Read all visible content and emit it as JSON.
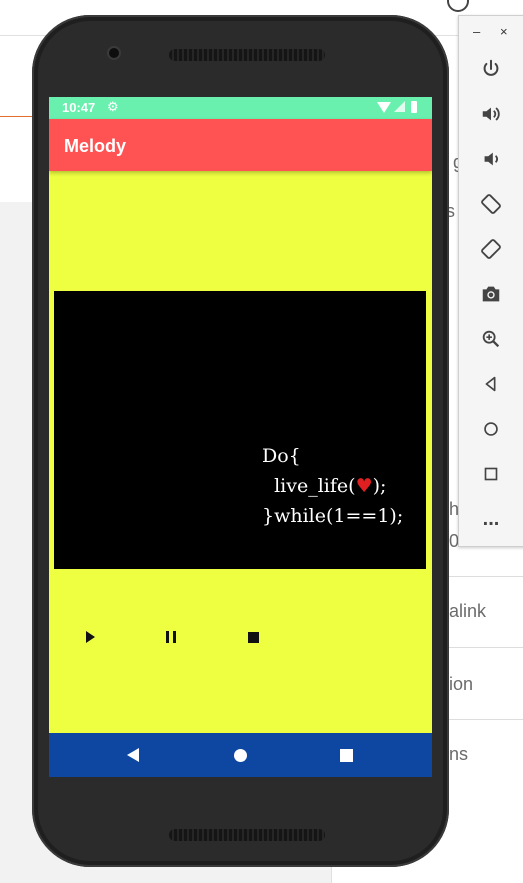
{
  "background": {
    "right_texts": [
      "g",
      "s",
      "h",
      "0",
      "alink",
      "ion",
      "ns"
    ]
  },
  "statusbar": {
    "time": "10:47",
    "settings_icon": "gear-icon",
    "wifi_icon": "wifi-icon",
    "signal_icon": "signal-icon",
    "battery_icon": "battery-icon",
    "color": "#69f0ae"
  },
  "appbar": {
    "title": "Melody",
    "color": "#ff5252"
  },
  "screen": {
    "background": "#eeff41"
  },
  "video": {
    "line1": "Do{",
    "line2_prefix": "  live_life(",
    "heart": "♥",
    "line2_suffix": ");",
    "line3": "}while(1==1);"
  },
  "controls": {
    "play_icon": "play-icon",
    "pause_icon": "pause-icon",
    "stop_icon": "stop-icon"
  },
  "navbar": {
    "color": "#0d47a1",
    "back_icon": "back-icon",
    "home_icon": "home-icon",
    "recent_icon": "recent-apps-icon"
  },
  "emulator": {
    "minimize": "–",
    "close": "×",
    "buttons": [
      "power-icon",
      "volume-up-icon",
      "volume-down-icon",
      "rotate-left-icon",
      "rotate-right-icon",
      "camera-icon",
      "zoom-icon",
      "back-icon",
      "home-icon",
      "overview-icon",
      "more-icon"
    ],
    "more_label": "..."
  }
}
